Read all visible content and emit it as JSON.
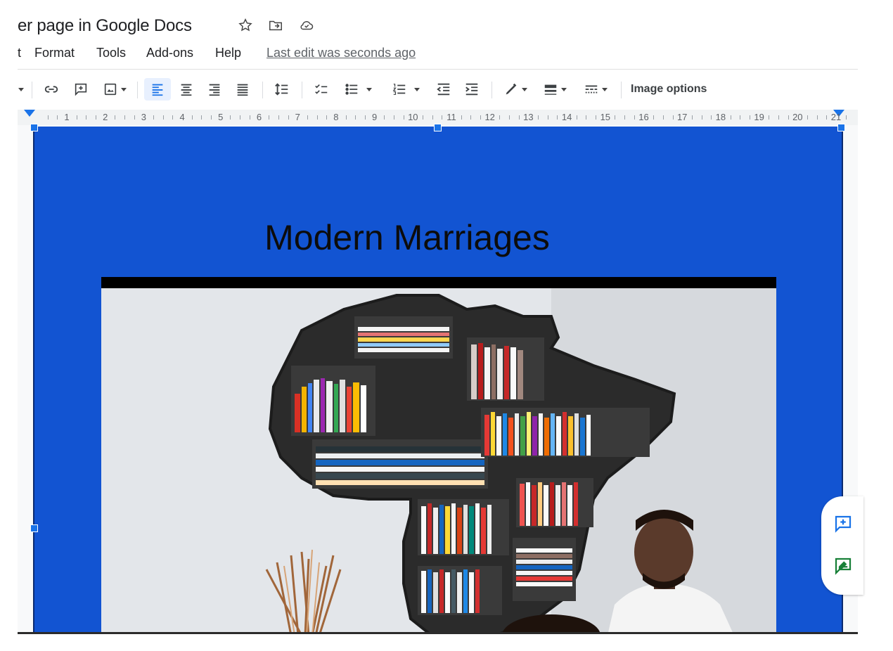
{
  "document": {
    "title_visible": "er page in Google Docs"
  },
  "title_icons": [
    "star-icon",
    "move-to-folder-icon",
    "cloud-saved-icon"
  ],
  "menu": {
    "cut_item": "t",
    "items": [
      "Format",
      "Tools",
      "Add-ons",
      "Help"
    ],
    "last_edit": "Last edit was seconds ago"
  },
  "toolbar": {
    "icons": [
      "dropdown-caret-icon",
      "link-icon",
      "add-comment-icon",
      "insert-image-icon",
      "align-left-icon",
      "align-center-icon",
      "align-right-icon",
      "justify-icon",
      "line-spacing-icon",
      "checklist-icon",
      "bulleted-list-icon",
      "numbered-list-icon",
      "decrease-indent-icon",
      "increase-indent-icon",
      "border-color-icon",
      "border-weight-icon",
      "border-dash-icon"
    ],
    "active_alignment": "align-left",
    "image_options": "Image options"
  },
  "ruler": {
    "labels": [
      "1",
      "2",
      "3",
      "4",
      "5",
      "6",
      "7",
      "8",
      "9",
      "10",
      "11",
      "12",
      "13",
      "14",
      "15",
      "16",
      "17",
      "18",
      "19",
      "20",
      "21"
    ]
  },
  "page": {
    "heading": "Modern Marriages",
    "background_color": "#1254d2",
    "image_description_icon": "bookshelf-photo"
  },
  "side_panel": {
    "buttons": [
      "add-comment-icon",
      "suggest-edit-icon"
    ],
    "colors": {
      "comment": "#1a73e8",
      "suggest": "#188038"
    }
  },
  "colors": {
    "accent": "#1a73e8",
    "page_blue": "#1254d2"
  }
}
